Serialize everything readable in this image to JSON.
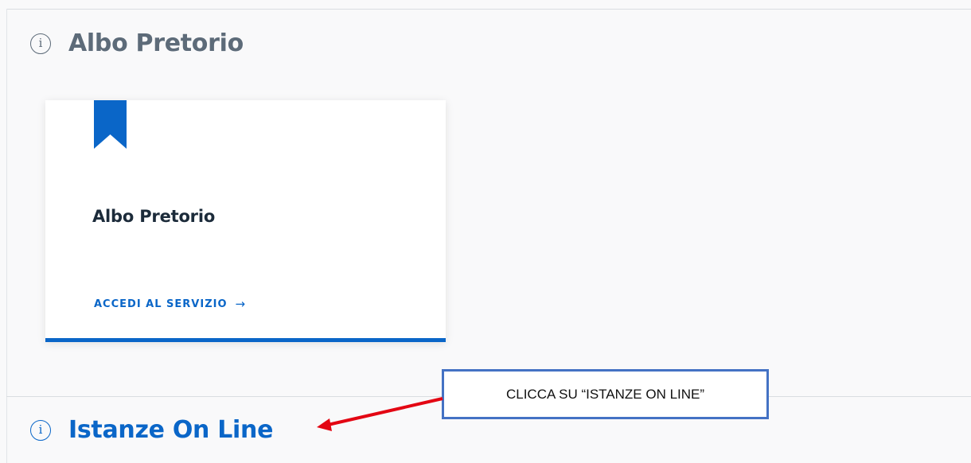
{
  "albo_section": {
    "title": "Albo Pretorio",
    "icon": "info-circle-icon",
    "color": "#5d6b79"
  },
  "card": {
    "icon": "bookmark-icon",
    "title": "Albo Pretorio",
    "link_label": "ACCEDI AL SERVIZIO",
    "link_arrow": "→",
    "accent_color": "#0a66c8"
  },
  "istanze_section": {
    "title": "Istanze On Line",
    "icon": "info-circle-icon",
    "color": "#0a66c8"
  },
  "annotation": {
    "text": "CLICCA SU “ISTANZE ON LINE”",
    "border_color": "#4472c4",
    "arrow_color": "#e30613"
  }
}
